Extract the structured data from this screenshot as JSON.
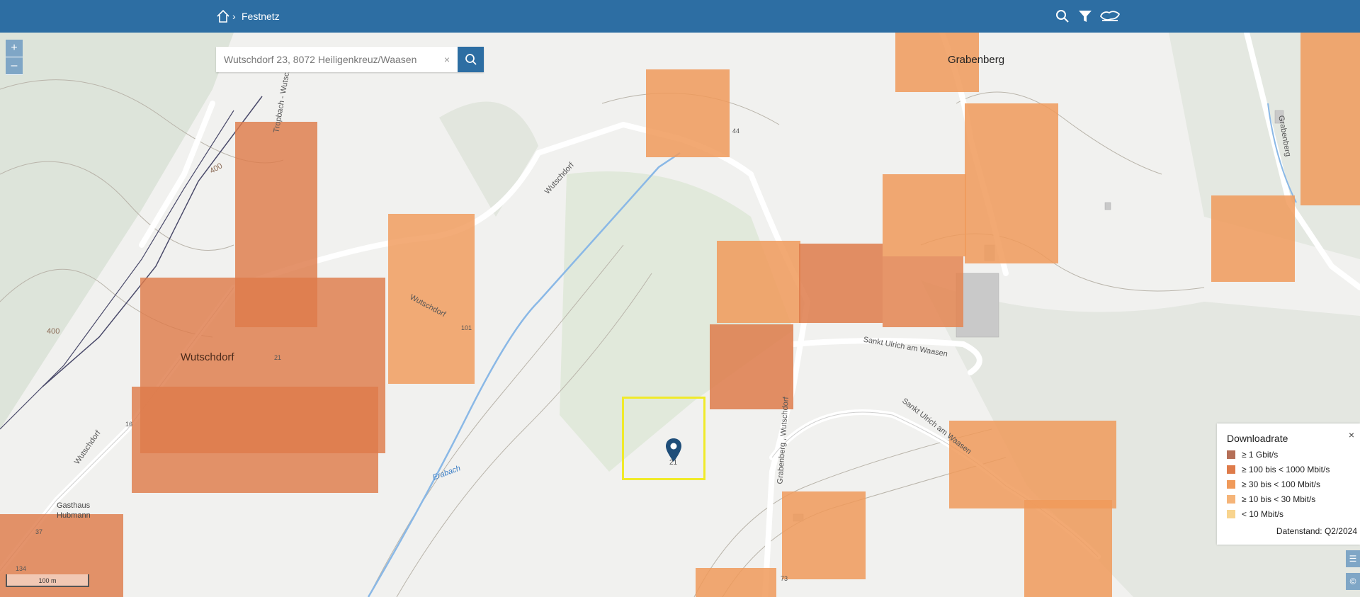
{
  "breadcrumb": {
    "current": "Festnetz"
  },
  "search": {
    "value": "Wutschdorf 23, 8072 Heiligenkreuz/Waasen",
    "clear_label": "×"
  },
  "zoom": {
    "in_label": "+",
    "out_label": "–"
  },
  "map": {
    "places": {
      "wutschdorf": "Wutschdorf",
      "grabenberg": "Grabenberg",
      "gasthaus": "Gasthaus",
      "hubmann": "Hubmann"
    },
    "roads": {
      "wutschdorf_1": "Wutschdorf",
      "wutschdorf_2": "Wutschdorf",
      "wutschdorf_3": "Wutschdorf",
      "sankt_ulrich_1": "Sankt Ulrich am Waasen",
      "sankt_ulrich_2": "Sankt Ulrich am Waasen",
      "grabenberg_wutschdorf": "Grabenberg , Wutschdorf",
      "tropbach": "Tropbach - Wutsch",
      "erabach": "Erabach",
      "grabenberg_road": "Grabenberg"
    },
    "contours": {
      "c400a": "400",
      "c400b": "400"
    },
    "house_numbers": {
      "h16": "16",
      "h21": "21",
      "h101": "101",
      "h44": "44",
      "h73": "73",
      "h37": "37",
      "h134": "134"
    },
    "marker_label": "21"
  },
  "legend": {
    "title": "Downloadrate",
    "close_label": "×",
    "items": [
      {
        "label": "≥ 1 Gbit/s",
        "color": "#b56f57"
      },
      {
        "label": "≥ 100 bis < 1000 Mbit/s",
        "color": "#de7b4a"
      },
      {
        "label": "≥ 30 bis < 100 Mbit/s",
        "color": "#f09a5a"
      },
      {
        "label": "≥ 10 bis < 30 Mbit/s",
        "color": "#f5b478"
      },
      {
        "label": "< 10 Mbit/s",
        "color": "#f8d48e"
      }
    ],
    "data_status": "Datenstand: Q2/2024"
  },
  "scale": {
    "label": "100 m"
  },
  "colors": {
    "header": "#2d6ea3",
    "coverage_100_1000": "#de7b4a",
    "coverage_30_100": "#f09a5a",
    "selection": "#f0ea2a"
  }
}
